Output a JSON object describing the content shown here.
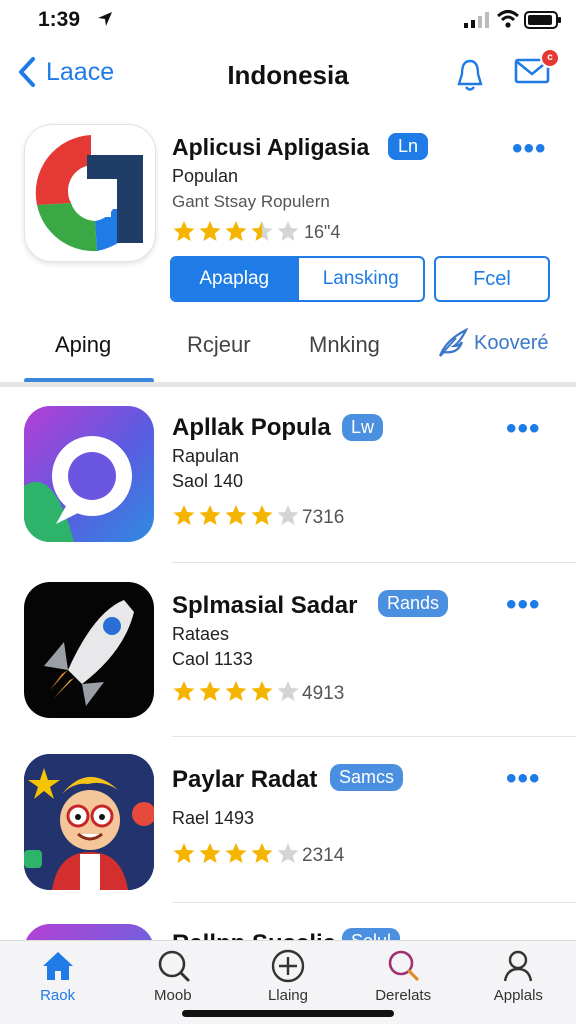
{
  "status_bar": {
    "time": "1:39"
  },
  "nav": {
    "back_label": "Laace",
    "title": "Indonesia",
    "mail_badge": "c"
  },
  "featured": {
    "name": "Aplicusi Apligasia",
    "badge": "Ln",
    "subtitle": "Populan",
    "description": "Gant Stsay Ropulern",
    "rating_stars": 3.5,
    "count": "16\"4",
    "segments": [
      "Apaplag",
      "Lansking"
    ],
    "active_segment": 0,
    "secondary_button": "Fcel"
  },
  "tabs": {
    "items": [
      "Aping",
      "Rcjeur",
      "Mnking"
    ],
    "active": 0,
    "extra_label": "Kooveré"
  },
  "apps": [
    {
      "name": "Apllak Popula",
      "badge": "Lw",
      "line1": "Rapulan",
      "line2": "Saol 140",
      "rating_stars": 4,
      "count": "7316",
      "icon": "chat-bubble-icon"
    },
    {
      "name": "Splmasial Sadar",
      "badge": "Rands",
      "line1": "Rataes",
      "line2": "Caol 1133",
      "rating_stars": 4,
      "count": "4913",
      "icon": "rocket-icon"
    },
    {
      "name": "Paylar Radat",
      "badge": "Samcs",
      "line1": "",
      "line2": "Rael 1493",
      "rating_stars": 4,
      "count": "2314",
      "icon": "cartoon-character-icon"
    },
    {
      "name": "Rallpp Susslia",
      "badge": "Solul",
      "line1": "",
      "line2": "",
      "rating_stars": 0,
      "count": "",
      "icon": "app-icon"
    }
  ],
  "tabbar": {
    "items": [
      {
        "label": "Raok",
        "icon": "home-icon"
      },
      {
        "label": "Moob",
        "icon": "search-icon"
      },
      {
        "label": "Llaing",
        "icon": "plus-circle-icon"
      },
      {
        "label": "Derelats",
        "icon": "search-icon"
      },
      {
        "label": "Applals",
        "icon": "person-icon"
      }
    ],
    "active": 0
  },
  "colors": {
    "accent": "#1f7be6",
    "star": "#f5b400",
    "star_empty": "#d5d5d5"
  }
}
